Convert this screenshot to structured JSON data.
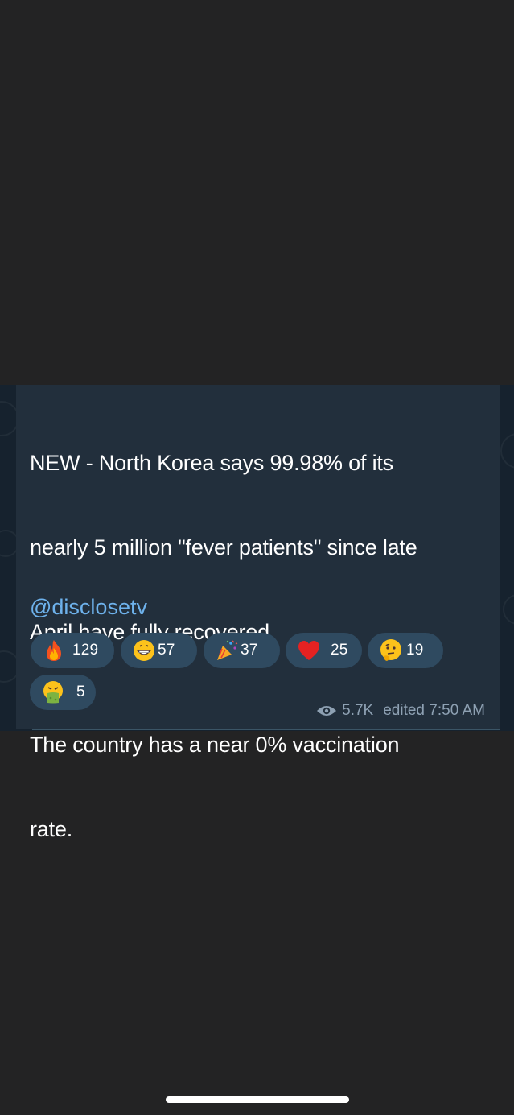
{
  "message": {
    "line1": "NEW - North Korea says 99.98% of its",
    "line2": "nearly 5 million \"fever patients\" since late",
    "line3": "April have fully recovered.",
    "line4": "The country has a near 0% vaccination",
    "line5": "rate.",
    "mention": "@disclosetv"
  },
  "reactions": [
    {
      "icon": "fire-emoji-icon",
      "count": "129"
    },
    {
      "icon": "grinning-face-emoji-icon",
      "count": "57"
    },
    {
      "icon": "party-popper-emoji-icon",
      "count": "37"
    },
    {
      "icon": "red-heart-emoji-icon",
      "count": "25"
    },
    {
      "icon": "thinking-face-emoji-icon",
      "count": "19"
    },
    {
      "icon": "vomiting-face-emoji-icon",
      "count": "5"
    }
  ],
  "meta": {
    "views": "5.7K",
    "edited": "edited 7:50 AM"
  },
  "colors": {
    "background": "#232324",
    "bubble": "#222f3c",
    "reaction_pill": "#2f4a60",
    "mention": "#6eb2ec",
    "meta_text": "#8ea1b3"
  }
}
